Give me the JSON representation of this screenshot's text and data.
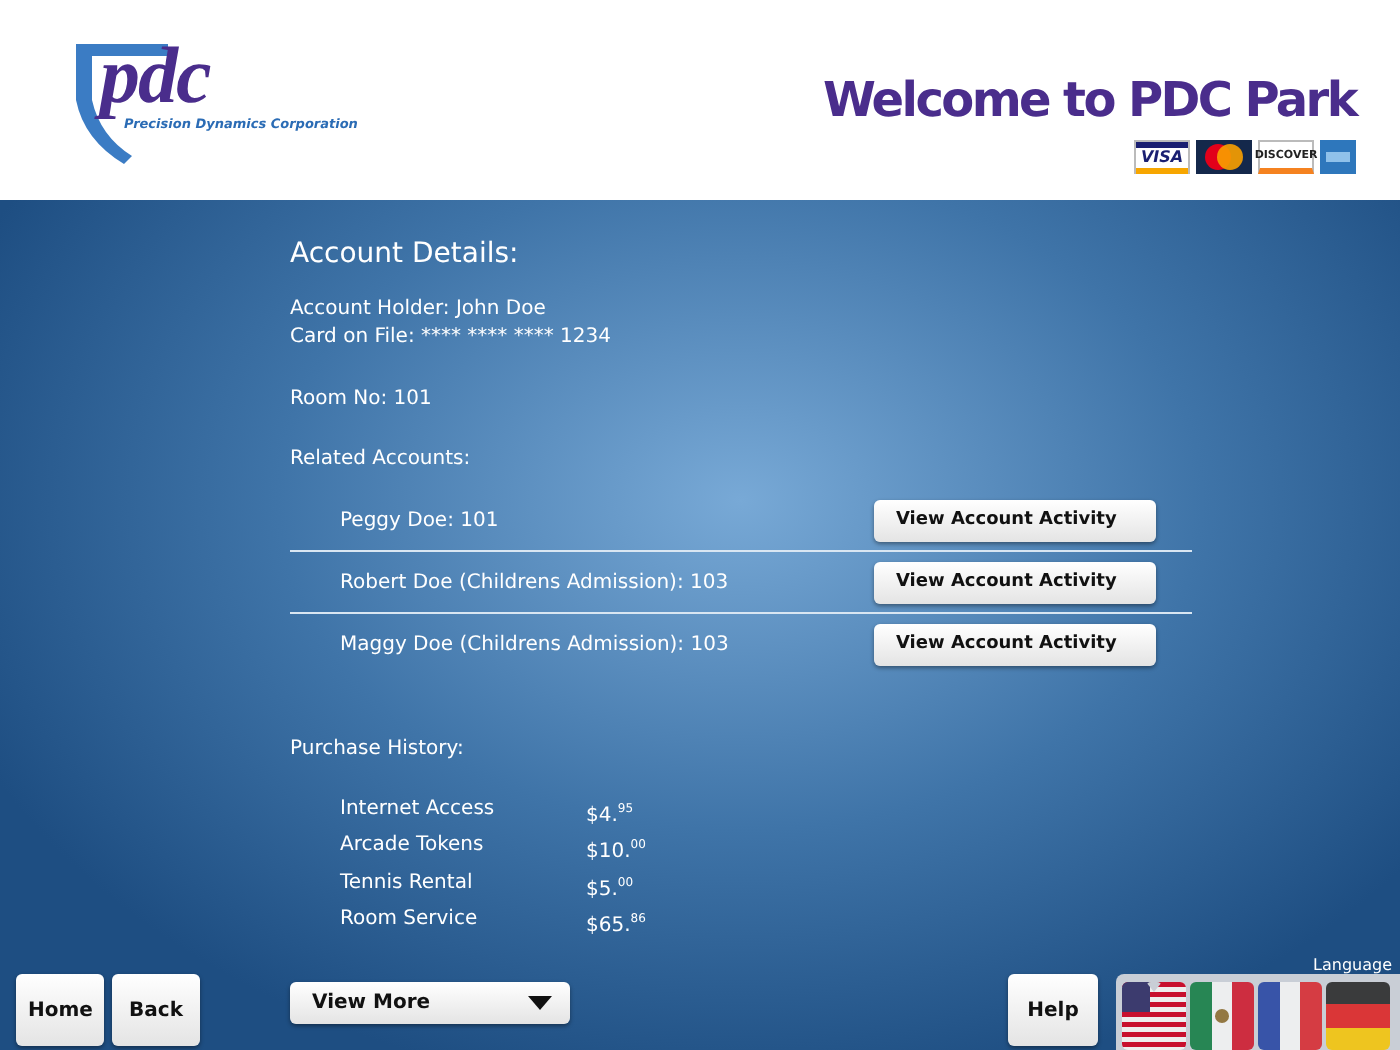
{
  "header": {
    "logo_mark": "pdc",
    "logo_caption": "Precision Dynamics Corporation",
    "title": "Welcome to PDC Park",
    "cards": [
      {
        "kind": "visa",
        "label": "VISA"
      },
      {
        "kind": "mastercard"
      },
      {
        "kind": "discover",
        "label": "DISCOVER"
      },
      {
        "kind": "amex"
      }
    ]
  },
  "account": {
    "title": "Account Details:",
    "holder": "Account Holder: John Doe",
    "card": "Card on File: **** **** **** 1234",
    "room": "Room No: 101",
    "related_title": "Related Accounts:",
    "related": [
      {
        "name": "Peggy Doe: 101",
        "button": "View Account Activity"
      },
      {
        "name": "Robert Doe (Childrens Admission): 103",
        "button": "View Account Activity"
      },
      {
        "name": "Maggy Doe (Childrens Admission): 103",
        "button": "View Account Activity"
      }
    ],
    "purchase_title": "Purchase History:",
    "purchases": [
      {
        "item": "Internet Access",
        "price": "$4.$^{95}$"
      },
      {
        "item": "Arcade Tokens",
        "price": "$10.$^{00}$"
      },
      {
        "item": "Tennis Rental",
        "price": "$5.$^{00}$"
      },
      {
        "item": "Room Service",
        "price": "$65.$^{86}$"
      }
    ],
    "view_more": "View More"
  },
  "footer": {
    "buttons": [
      "Home",
      "Back"
    ],
    "help": "Help",
    "language_label": "Language",
    "languages": [
      {
        "kind": "us",
        "selected": true
      },
      {
        "kind": "mexico",
        "selected": false
      },
      {
        "kind": "france",
        "selected": false
      },
      {
        "kind": "germany",
        "selected": false
      }
    ]
  }
}
